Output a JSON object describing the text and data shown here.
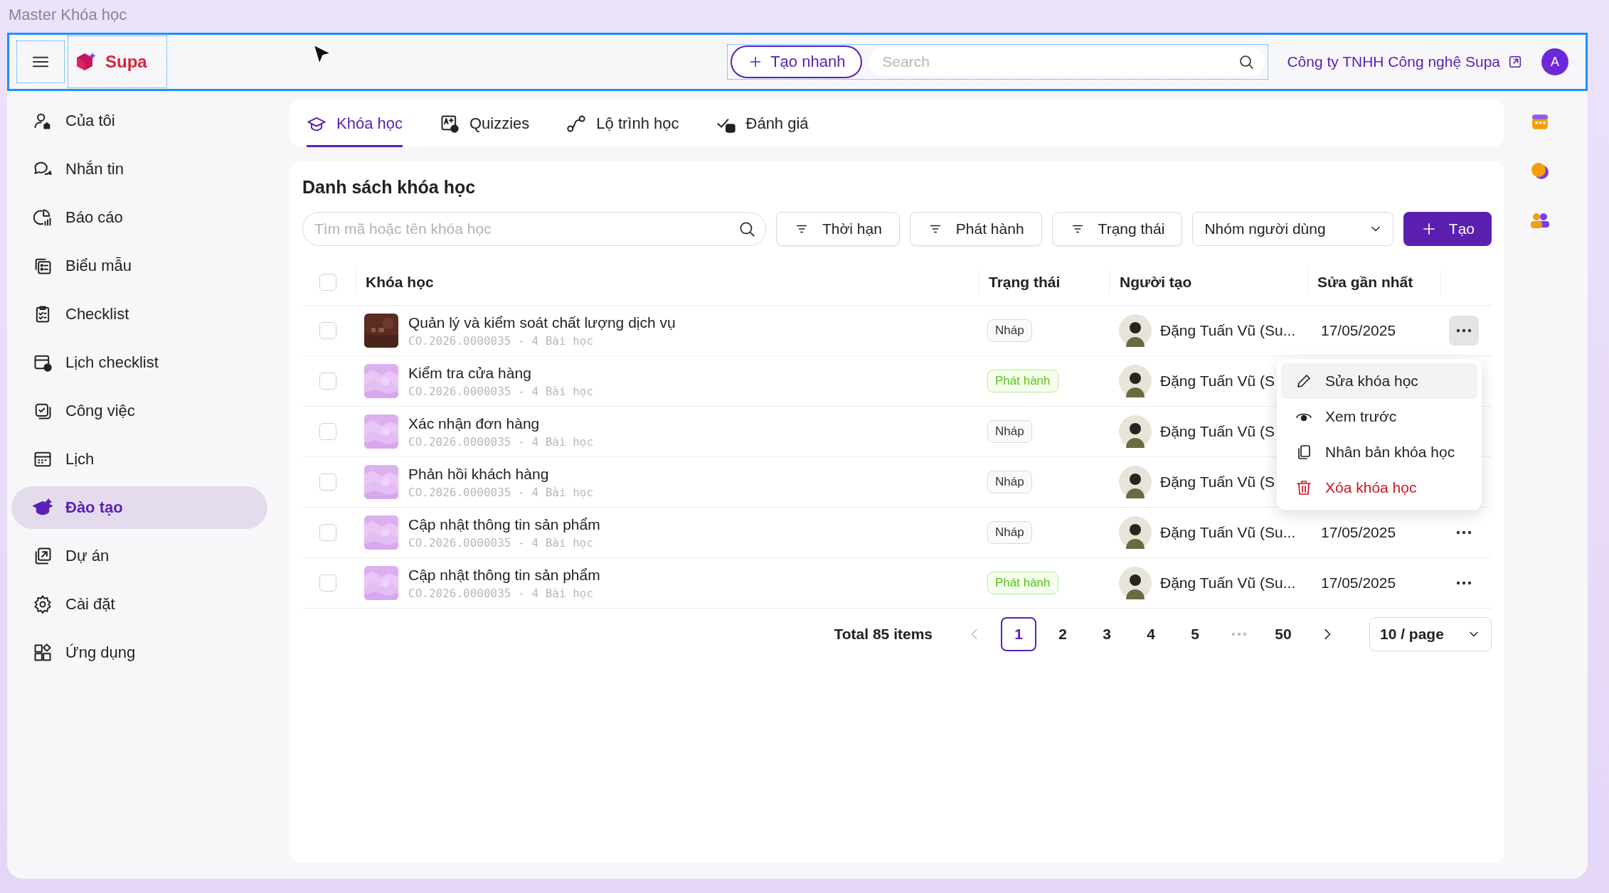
{
  "window": {
    "title": "Master Khóa học"
  },
  "header": {
    "brand": "Supa",
    "quick_create": "Tạo nhanh",
    "search": {
      "placeholder": "Search"
    },
    "company": "Công ty TNHH Công nghệ Supa",
    "avatar": "A"
  },
  "sidebar": {
    "items": [
      {
        "label": "Của tôi",
        "selected": false
      },
      {
        "label": "Nhắn tin",
        "selected": false
      },
      {
        "label": "Báo cáo",
        "selected": false
      },
      {
        "label": "Biểu mẫu",
        "selected": false
      },
      {
        "label": "Checklist",
        "selected": false
      },
      {
        "label": "Lịch checklist",
        "selected": false
      },
      {
        "label": "Công việc",
        "selected": false
      },
      {
        "label": "Lịch",
        "selected": false
      },
      {
        "label": "Đào tạo",
        "selected": true
      },
      {
        "label": "Dự án",
        "selected": false
      },
      {
        "label": "Cài đặt",
        "selected": false
      },
      {
        "label": "Ứng dụng",
        "selected": false
      }
    ]
  },
  "tabs": [
    {
      "label": "Khóa học",
      "selected": true
    },
    {
      "label": "Quizzies",
      "selected": false
    },
    {
      "label": "Lộ trình học",
      "selected": false
    },
    {
      "label": "Đánh giá",
      "selected": false
    }
  ],
  "list": {
    "title": "Danh sách khóa học",
    "search": {
      "placeholder": "Tìm mã hoặc tên khóa học"
    },
    "filters": [
      "Thời hạn",
      "Phát hành",
      "Trạng thái"
    ],
    "group_select": {
      "value": "Nhóm người dùng"
    },
    "create_button": "Tạo"
  },
  "table": {
    "select_all": {
      "checked": false
    },
    "columns": [
      "Khóa học",
      "Trạng thái",
      "Người tạo",
      "Sửa gần nhất"
    ],
    "rows": [
      {
        "checked": false,
        "thumbnail": {
          "kind": "dark"
        },
        "name": "Quản lý và kiểm soát chất lượng dịch vụ",
        "meta": "CO.2026.0000035 - 4 Bài học",
        "status": {
          "label": "Nháp",
          "kind": "draft"
        },
        "creator": "Đặng Tuấn Vũ (Su...",
        "modified": "17/05/2025",
        "more_button": {
          "open": true
        }
      },
      {
        "checked": false,
        "thumbnail": {
          "kind": "gradient"
        },
        "name": "Kiểm tra cửa hàng",
        "meta": "CO.2026.0000035 - 4 Bài học",
        "status": {
          "label": "Phát hành",
          "kind": "published"
        },
        "creator": "Đặng Tuấn Vũ (S"
      },
      {
        "checked": false,
        "thumbnail": {
          "kind": "gradient"
        },
        "name": "Xác nhận đơn hàng",
        "meta": "CO.2026.0000035 - 4 Bài học",
        "status": {
          "label": "Nháp",
          "kind": "draft"
        },
        "creator": "Đặng Tuấn Vũ (S"
      },
      {
        "checked": false,
        "thumbnail": {
          "kind": "gradient"
        },
        "name": "Phản hồi khách hàng",
        "meta": "CO.2026.0000035 - 4 Bài học",
        "status": {
          "label": "Nháp",
          "kind": "draft"
        },
        "creator": "Đặng Tuấn Vũ (S"
      },
      {
        "checked": false,
        "thumbnail": {
          "kind": "gradient"
        },
        "name": "Cập nhật thông tin sản phẩm",
        "meta": "CO.2026.0000035 - 4 Bài học",
        "status": {
          "label": "Nháp",
          "kind": "draft"
        },
        "creator": "Đặng Tuấn Vũ (Su...",
        "modified": "17/05/2025",
        "more_button": {
          "open": false
        }
      },
      {
        "checked": false,
        "thumbnail": {
          "kind": "gradient"
        },
        "name": "Cập nhật thông tin sản phẩm",
        "meta": "CO.2026.0000035 - 4 Bài học",
        "status": {
          "label": "Phát hành",
          "kind": "published"
        },
        "creator": "Đặng Tuấn Vũ (Su...",
        "modified": "17/05/2025",
        "more_button": {
          "open": false
        }
      }
    ]
  },
  "context_menu": {
    "items": [
      {
        "label": "Sửa khóa học",
        "kind": "edit",
        "highlighted": true
      },
      {
        "label": "Xem trước",
        "kind": "preview",
        "highlighted": false
      },
      {
        "label": "Nhân bản khóa học",
        "kind": "duplicate",
        "highlighted": false
      },
      {
        "label": "Xóa khóa học",
        "kind": "delete",
        "highlighted": false
      }
    ]
  },
  "pagination": {
    "total": "Total 85 items",
    "prev": {
      "disabled": true
    },
    "next": {
      "disabled": false
    },
    "pages": [
      {
        "kind": "page",
        "label": "1",
        "selected": true
      },
      {
        "kind": "page",
        "label": "2",
        "selected": false
      },
      {
        "kind": "page",
        "label": "3",
        "selected": false
      },
      {
        "kind": "page",
        "label": "4",
        "selected": false
      },
      {
        "kind": "page",
        "label": "5",
        "selected": false
      },
      {
        "kind": "ellipsis",
        "selected": false
      },
      {
        "kind": "page",
        "label": "50",
        "selected": false
      }
    ],
    "page_size": "10 / page"
  }
}
